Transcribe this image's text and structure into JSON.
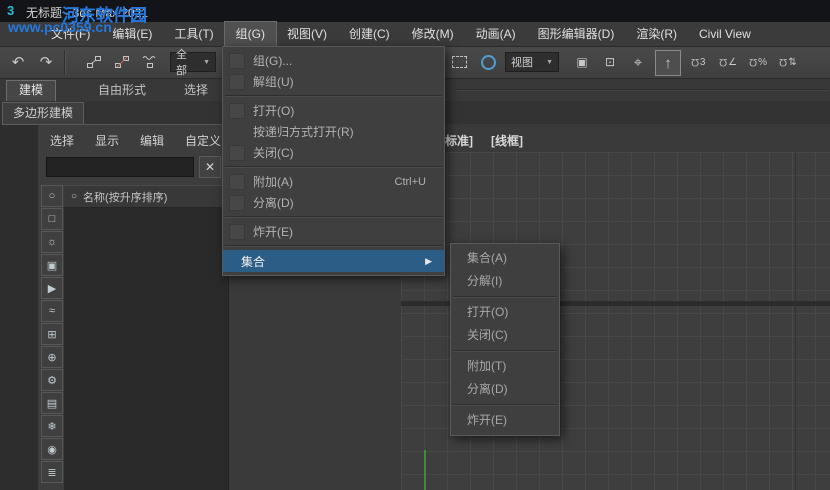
{
  "watermark": {
    "site_name": "河东软件园",
    "site_url": "www.pc0359.cn"
  },
  "title_bar": {
    "app_icon_glyph": "3",
    "title": "无标题 - 3ds Max 2021"
  },
  "menu_bar": {
    "items": [
      {
        "label": "文件(F)"
      },
      {
        "label": "编辑(E)"
      },
      {
        "label": "工具(T)"
      },
      {
        "label": "组(G)"
      },
      {
        "label": "视图(V)"
      },
      {
        "label": "创建(C)"
      },
      {
        "label": "修改(M)"
      },
      {
        "label": "动画(A)"
      },
      {
        "label": "图形编辑器(D)"
      },
      {
        "label": "渲染(R)"
      },
      {
        "label": "Civil View"
      }
    ]
  },
  "toolbar": {
    "selection_filter_value": "全部",
    "reference_coord_value": "视图",
    "snap_labels": {
      "snap3": "3",
      "angle": "∠",
      "percent": "%",
      "spinner": "⇅"
    }
  },
  "ribbon": {
    "tabs": [
      {
        "label": "建模"
      },
      {
        "label": "自由形式"
      },
      {
        "label": "选择"
      }
    ],
    "subtab": "多边形建模"
  },
  "scene_explorer": {
    "tabs": [
      "选择",
      "显示",
      "编辑",
      "自定义"
    ],
    "search_value": "",
    "column_header": "名称(按升序排序)",
    "filter_icons": [
      "○",
      "□",
      "☼",
      "▣",
      "▶",
      "≈",
      "⊞",
      "⊕",
      "⚙",
      "▤",
      "❄",
      "◉",
      "≣"
    ]
  },
  "group_menu": {
    "items": [
      {
        "label": "组(G)..."
      },
      {
        "label": "解组(U)"
      },
      {
        "label": "打开(O)"
      },
      {
        "label": "按递归方式打开(R)"
      },
      {
        "label": "关闭(C)"
      },
      {
        "label": "附加(A)",
        "shortcut": "Ctrl+U"
      },
      {
        "label": "分离(D)"
      },
      {
        "label": "炸开(E)"
      },
      {
        "label": "集合"
      }
    ]
  },
  "assembly_submenu": {
    "items": [
      {
        "label": "集合(A)"
      },
      {
        "label": "分解(I)"
      },
      {
        "label": "打开(O)"
      },
      {
        "label": "关闭(C)"
      },
      {
        "label": "附加(T)"
      },
      {
        "label": "分离(D)"
      },
      {
        "label": "炸开(E)"
      }
    ]
  },
  "viewport": {
    "label_standard": "[标准]",
    "label_wireframe": "[线框]"
  },
  "icons": {
    "undo": "↶",
    "redo": "↷",
    "clear": "✕",
    "dropdown_arrow": "▼",
    "submenu_arrow": "▶",
    "name_column_circle": "○",
    "move": "⌖",
    "up_arrow": "↑",
    "ribbon_collapse": "▼"
  }
}
